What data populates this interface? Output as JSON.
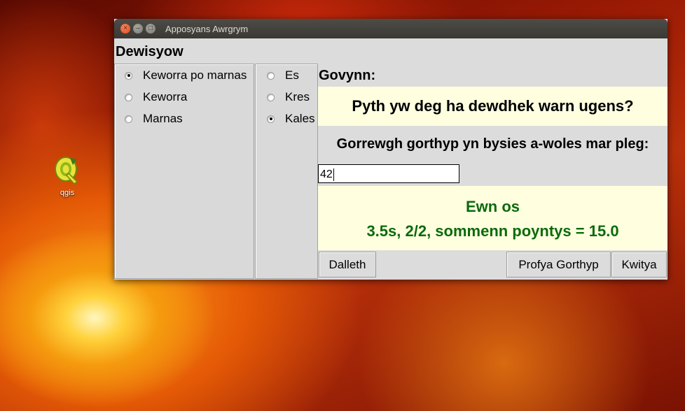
{
  "desktop": {
    "icon_label": "qgis"
  },
  "window": {
    "title": "Apposyans Awrgrym",
    "controls": {
      "close": "×",
      "minimize": "–",
      "maximize": "□"
    }
  },
  "options": {
    "heading": "Dewisyow",
    "modes": [
      {
        "label": "Keworra po marnas",
        "selected": true
      },
      {
        "label": "Keworra",
        "selected": false
      },
      {
        "label": "Marnas",
        "selected": false
      }
    ],
    "difficulty": [
      {
        "label": "Es",
        "selected": false
      },
      {
        "label": "Kres",
        "selected": false
      },
      {
        "label": "Kales",
        "selected": true
      }
    ]
  },
  "question": {
    "label": "Govynn:",
    "text": "Pyth yw deg ha dewdhek warn ugens?"
  },
  "instruction": "Gorrewgh gorthyp yn bysies a-woles mar pleg:",
  "answer": {
    "value": "42"
  },
  "result": {
    "line1": "Ewn os",
    "line2": "3.5s, 2/2, sommenn poyntys = 15.0",
    "color": "#0b6a0b"
  },
  "buttons": {
    "start": "Dalleth",
    "check": "Profya Gorthyp",
    "quit": "Kwitya"
  }
}
